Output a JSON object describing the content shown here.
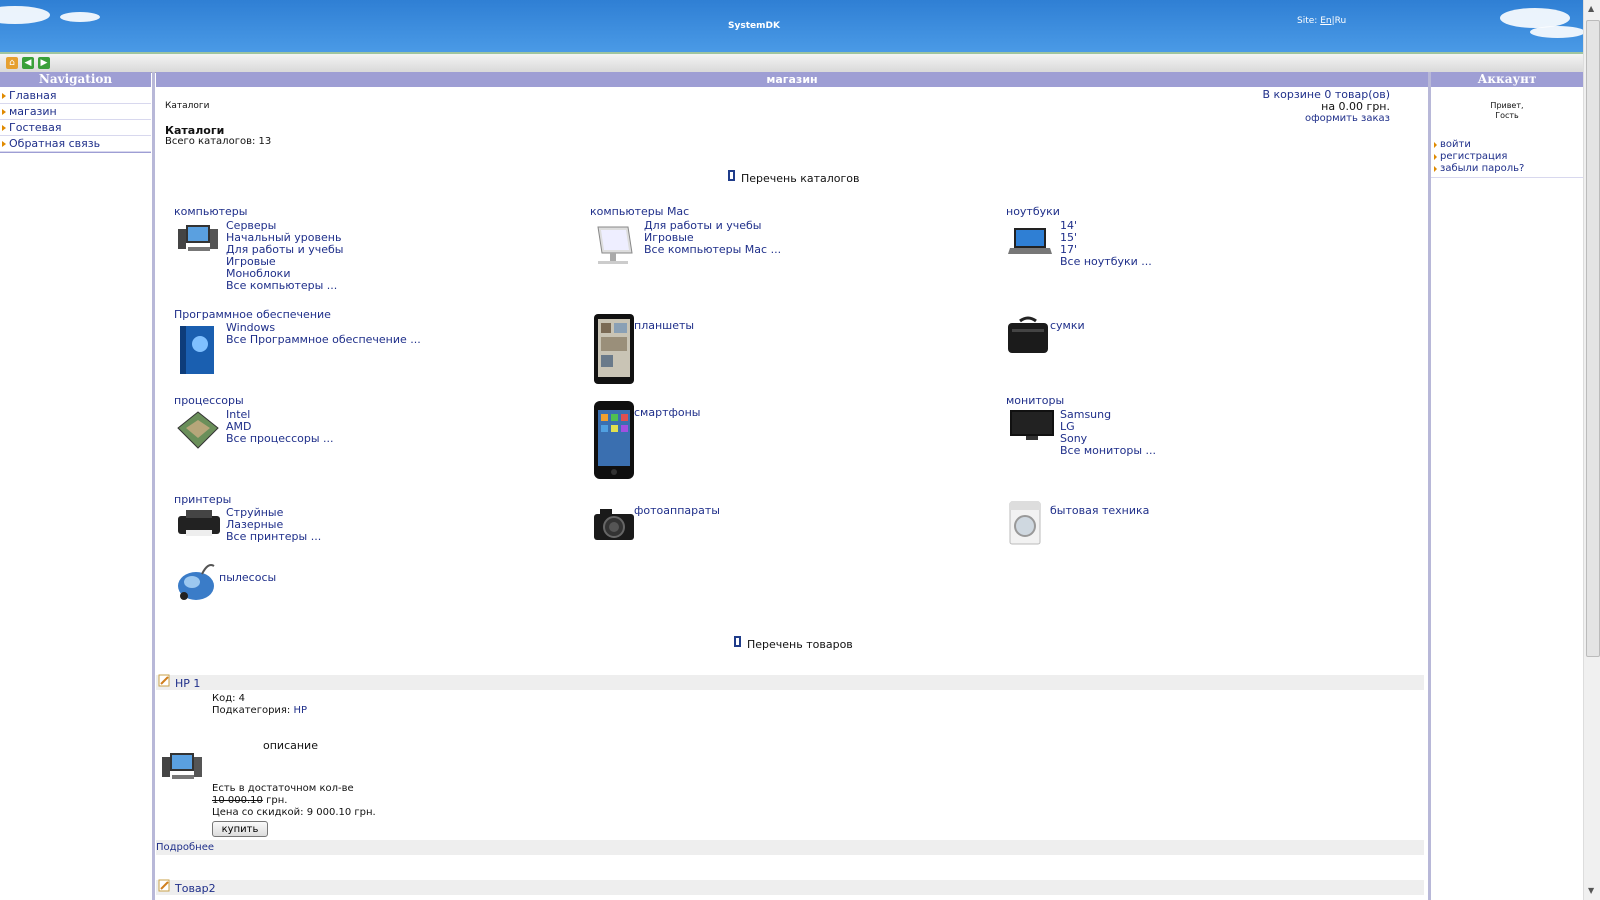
{
  "header": {
    "site_title": "SystemDK",
    "lang_label": "Site:",
    "lang_en": "En",
    "lang_sep": "|",
    "lang_ru": "Ru"
  },
  "toolbar": {
    "buttons": [
      "home-icon",
      "back-icon",
      "forward-icon"
    ]
  },
  "nav": {
    "title": "Navigation",
    "items": [
      {
        "label": "Главная"
      },
      {
        "label": "магазин"
      },
      {
        "label": "Гостевая"
      },
      {
        "label": "Обратная связь"
      }
    ]
  },
  "main": {
    "title": "магазин",
    "breadcrumb": "Каталоги",
    "cart_line1": "В корзине 0 товар(ов)",
    "cart_line2": "на 0.00 грн.",
    "cart_checkout": "оформить заказ",
    "section_heading": "Каталоги",
    "total_catalogs": "Всего каталогов: 13",
    "catalogs_list_title": "Перечень каталогов",
    "products_list_title": "Перечень товаров",
    "catalogs": [
      {
        "name": "компьютеры",
        "subs": [
          "Серверы",
          "Начальный уровень",
          "Для работы и учебы",
          "Игровые",
          "Моноблоки",
          "Все компьютеры ..."
        ]
      },
      {
        "name": "компьютеры Mac",
        "subs": [
          "Для работы и учебы",
          "Игровые",
          "Все компьютеры Mac ..."
        ]
      },
      {
        "name": "ноутбуки",
        "subs": [
          "14'",
          "15'",
          "17'",
          "Все ноутбуки ..."
        ]
      },
      {
        "name": "Программное обеспечение",
        "subs": [
          "Windows",
          "Все Программное обеспечение ..."
        ]
      },
      {
        "name": "планшеты",
        "subs": []
      },
      {
        "name": "сумки",
        "subs": []
      },
      {
        "name": "процессоры",
        "subs": [
          "Intel",
          "AMD",
          "Все процессоры ..."
        ]
      },
      {
        "name": "смартфоны",
        "subs": []
      },
      {
        "name": "мониторы",
        "subs": [
          "Samsung",
          "LG",
          "Sony",
          "Все мониторы ..."
        ]
      },
      {
        "name": "принтеры",
        "subs": [
          "Струйные",
          "Лазерные",
          "Все принтеры ..."
        ]
      },
      {
        "name": "фотоаппараты",
        "subs": []
      },
      {
        "name": "бытовая техника",
        "subs": []
      },
      {
        "name": "пылесосы",
        "subs": []
      }
    ],
    "products": [
      {
        "name": "HP 1",
        "code_label": "Код: 4",
        "subcat_label": "Подкатегория:",
        "subcat_value": "HP",
        "description": "описание",
        "stock": "Есть в достаточном кол-ве",
        "old_price": "10 000.10",
        "currency": "грн.",
        "discount_price": "Цена со скидкой: 9 000.10 грн.",
        "buy_label": "купить",
        "more_label": "Подробнее"
      },
      {
        "name": "Товар2"
      }
    ]
  },
  "account": {
    "title": "Аккаунт",
    "greeting1": "Привет,",
    "greeting2": "Гость",
    "links": [
      "войти",
      "регистрация",
      "забыли пароль?"
    ]
  },
  "colors": {
    "header_blue": "#2f7fd4",
    "panel_head": "#9e9ed4",
    "link": "#1f2f8a",
    "bullet": "#e08a00"
  }
}
